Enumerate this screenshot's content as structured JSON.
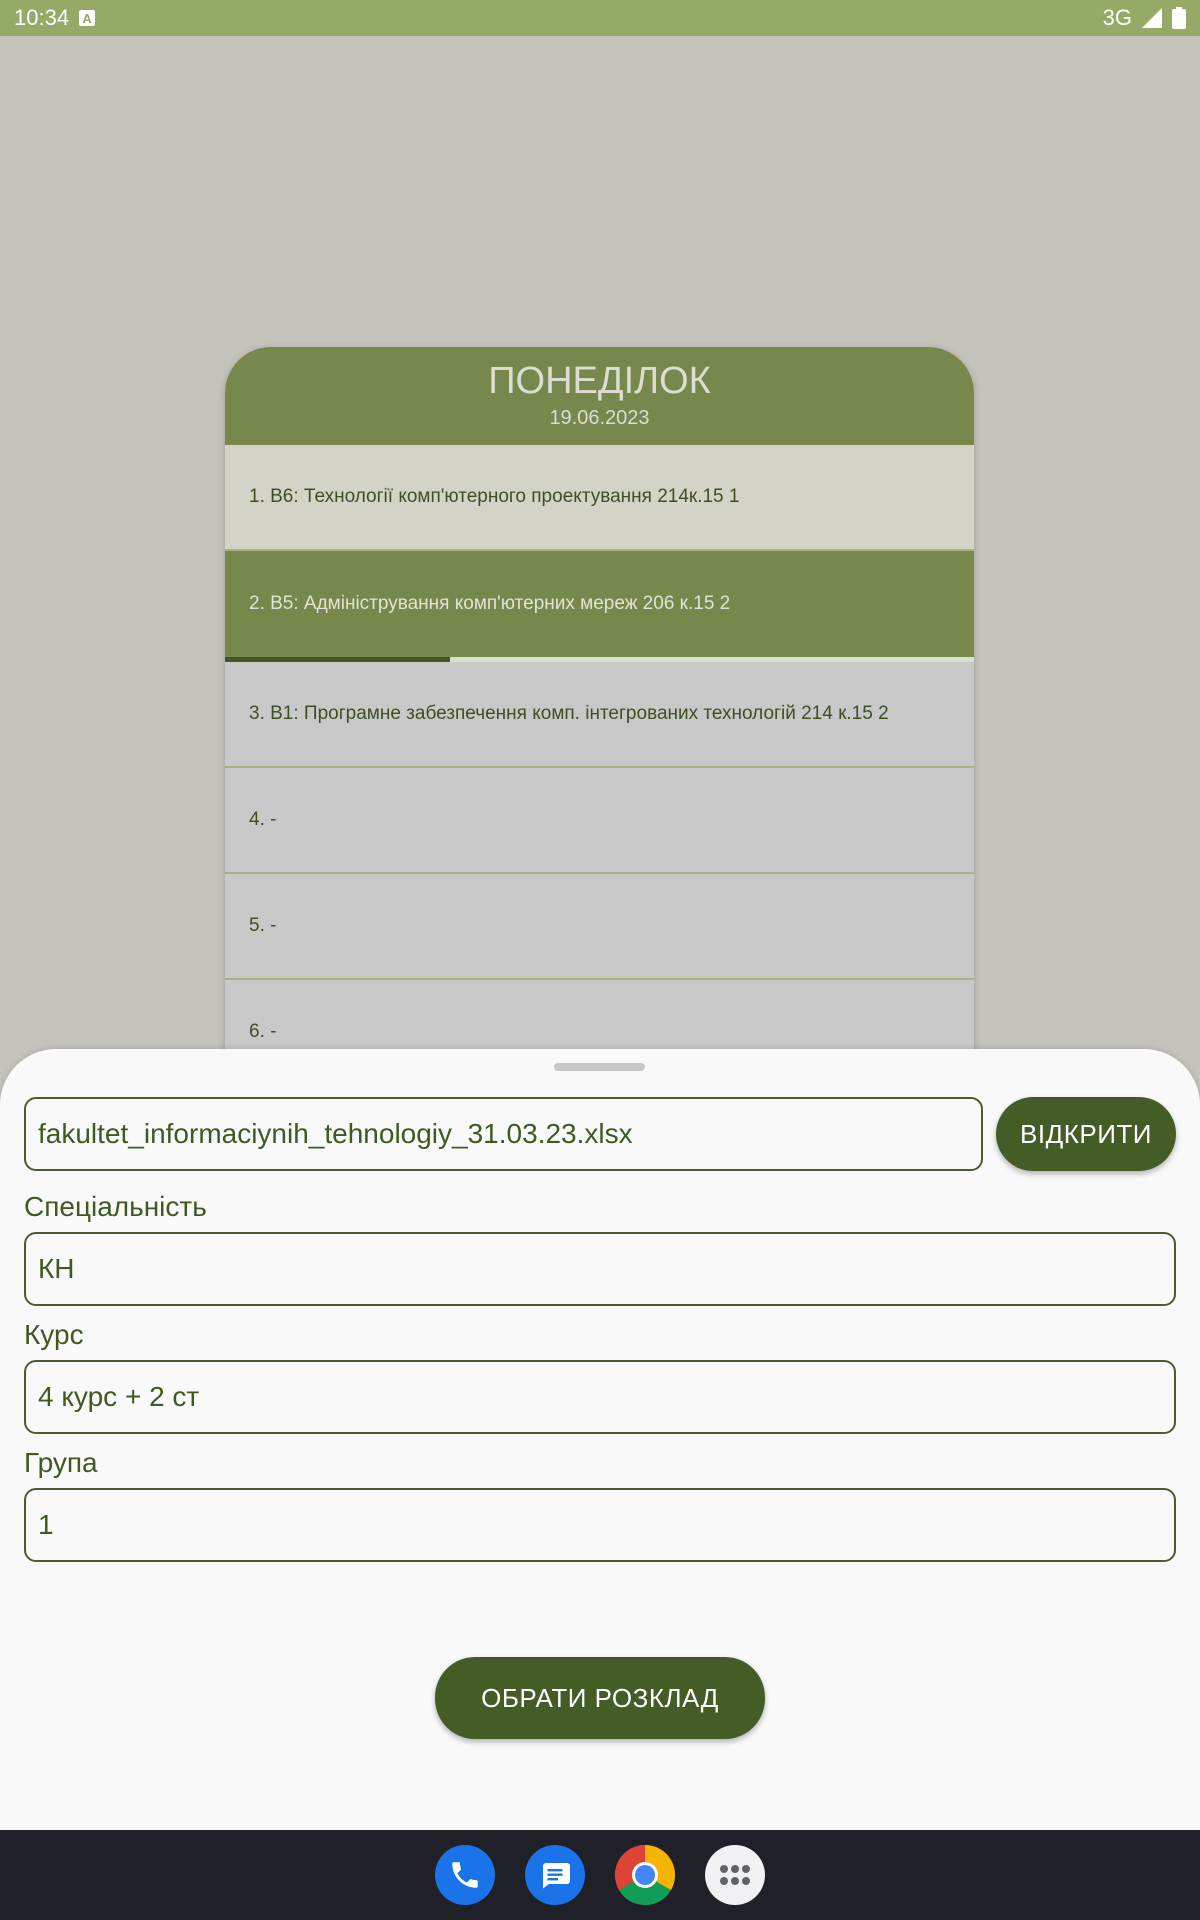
{
  "status_bar": {
    "time": "10:34",
    "network": "3G",
    "icons": [
      "a-notification-icon",
      "signal-icon",
      "battery-icon"
    ]
  },
  "schedule": {
    "day": "ПОНЕДІЛОК",
    "date": "19.06.2023",
    "lessons": [
      "1. B6: Технології комп'ютерного проектування 214к.15 1",
      "2. B5: Адміністрування комп'ютерних мереж 206 к.15 2",
      "3. B1: Програмне забезпечення комп. інтегрованих технологій 214 к.15 2",
      "4. -",
      "5. -",
      "6. -"
    ],
    "active_index": 1,
    "current_lesson_progress": 0.3
  },
  "sheet": {
    "file_name": "fakultet_informaciynih_tehnologiy_31.03.23.xlsx",
    "open_button": "ВІДКРИТИ",
    "specialty_label": "Спеціальність",
    "specialty_value": "КН",
    "course_label": "Курс",
    "course_value": "4 курс + 2 ст",
    "group_label": "Група",
    "group_value": "1",
    "select_button": "ОБРАТИ РОЗКЛАД"
  },
  "dock": {
    "apps": [
      "phone-icon",
      "messages-icon",
      "chrome-icon",
      "app-drawer-icon"
    ]
  },
  "colors": {
    "status_bar": "#95aa66",
    "card_header": "#77884d",
    "button": "#445c26",
    "text_green": "#3e5a22"
  }
}
